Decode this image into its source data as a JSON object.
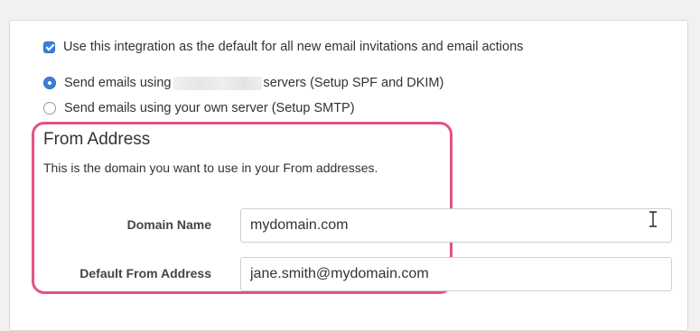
{
  "settings": {
    "default_integration_label": "Use this integration as the default for all new email invitations and email actions",
    "default_integration_checked": true,
    "send_options": [
      {
        "label_prefix": "Send emails using",
        "label_suffix": "servers (Setup SPF and DKIM)",
        "selected": true
      },
      {
        "label": "Send emails using your own server (Setup SMTP)",
        "selected": false
      }
    ]
  },
  "from_address": {
    "title": "From Address",
    "description": "This is the domain you want to use in your From addresses.",
    "fields": {
      "domain_name": {
        "label": "Domain Name",
        "value": "mydomain.com"
      },
      "default_from": {
        "label": "Default From Address",
        "value": "jane.smith@mydomain.com"
      }
    }
  },
  "colors": {
    "accent": "#3d7fd9",
    "highlight": "#e5537c"
  },
  "icons": {
    "cursor": "text-cursor-icon"
  }
}
